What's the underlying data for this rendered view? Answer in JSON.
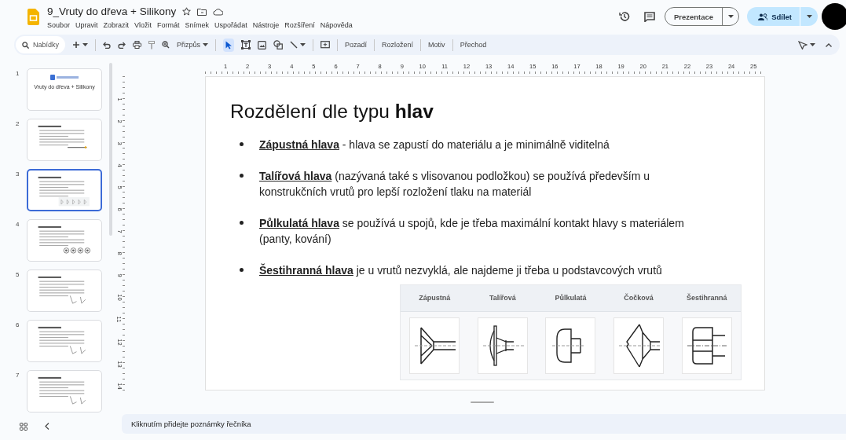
{
  "document": {
    "title": "9_Vruty do dřeva + Silikony"
  },
  "menu": [
    "Soubor",
    "Upravit",
    "Zobrazit",
    "Vložit",
    "Formát",
    "Snímek",
    "Uspořádat",
    "Nástroje",
    "Rozšíření",
    "Nápověda"
  ],
  "header_buttons": {
    "present": "Prezentace",
    "share": "Sdílet"
  },
  "toolbar": {
    "search_label": "Nabídky",
    "zoom_label": "Přizpůs",
    "items": [
      "Pozadí",
      "Rozložení",
      "Motiv",
      "Přechod"
    ]
  },
  "slides": [
    {
      "number": "1",
      "title": "Vruty do dřeva + Silikony",
      "selected": false
    },
    {
      "number": "2",
      "selected": false
    },
    {
      "number": "3",
      "selected": true
    },
    {
      "number": "4",
      "selected": false
    },
    {
      "number": "5",
      "selected": false
    },
    {
      "number": "6",
      "selected": false
    },
    {
      "number": "7",
      "selected": false
    }
  ],
  "ruler": {
    "horizontal": [
      "1",
      "2",
      "3",
      "4",
      "5",
      "6",
      "7",
      "8",
      "9",
      "10",
      "11",
      "12",
      "13",
      "14",
      "15",
      "16",
      "17",
      "18",
      "19",
      "20",
      "21",
      "22",
      "23",
      "24",
      "25"
    ],
    "vertical": [
      "1",
      "2",
      "3",
      "4",
      "5",
      "6",
      "7",
      "8",
      "9",
      "10",
      "11",
      "12",
      "13",
      "14"
    ]
  },
  "slide": {
    "title": "Rozdělení dle typu **hlav**",
    "bullets": [
      "**Zápustná hlava** - hlava se zapustí do materiálu a je minimálně viditelná",
      "**Talířová hlava** (nazývaná také s vlisovanou podložkou) se používá především u konstrukčních vrutů pro lepší rozložení tlaku na materiál",
      "**Půlkulatá hlava** se používá u spojů, kde je třeba maximální kontakt hlavy s materiálem (panty, kování)",
      "**Šestihranná hlava** je u vrutů nezvyklá, ale najdeme ji třeba u podstavcových vrutů"
    ],
    "figure": [
      {
        "label": "Zápustná",
        "kind": "countersunk"
      },
      {
        "label": "Talířová",
        "kind": "washer"
      },
      {
        "label": "Půlkulatá",
        "kind": "round"
      },
      {
        "label": "Čočková",
        "kind": "oval"
      },
      {
        "label": "Šestihranná",
        "kind": "hex"
      }
    ]
  },
  "notes": {
    "placeholder": "Kliknutím přidejte poznámky řečníka"
  }
}
